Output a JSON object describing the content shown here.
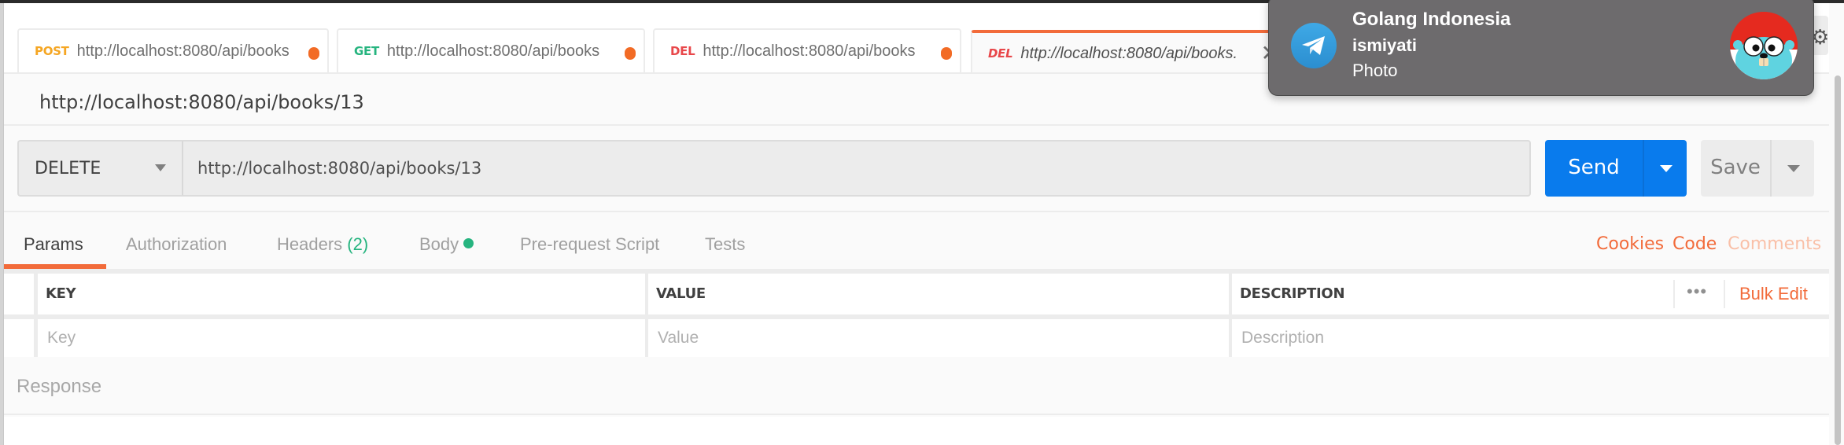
{
  "tabs": [
    {
      "method": "POST",
      "method_color": "#f5a623",
      "url": "http://localhost:8080/api/books",
      "unsaved": true
    },
    {
      "method": "GET",
      "method_color": "#26b47f",
      "url": "http://localhost:8080/api/books",
      "unsaved": true
    },
    {
      "method": "DEL",
      "method_color": "#e8474a",
      "url": "http://localhost:8080/api/books",
      "unsaved": true
    },
    {
      "method": "DEL",
      "method_color": "#e8474a",
      "url": "http://localhost:8080/api/books.",
      "active": true,
      "close_icon": "close-icon"
    }
  ],
  "request": {
    "name": "http://localhost:8080/api/books/13",
    "method": "DELETE",
    "url": "http://localhost:8080/api/books/13",
    "send_label": "Send",
    "save_label": "Save"
  },
  "request_tabs": [
    {
      "label": "Params",
      "active": true
    },
    {
      "label": "Authorization"
    },
    {
      "label": "Headers",
      "count": "(2)"
    },
    {
      "label": "Body",
      "indicator": "green-dot"
    },
    {
      "label": "Pre-request Script"
    },
    {
      "label": "Tests"
    }
  ],
  "right_links": {
    "cookies": "Cookies",
    "code": "Code",
    "comments": "Comments"
  },
  "params_table": {
    "headers": {
      "key": "KEY",
      "value": "VALUE",
      "description": "DESCRIPTION"
    },
    "more_label": "•••",
    "bulk_edit": "Bulk Edit",
    "placeholders": {
      "key": "Key",
      "value": "Value",
      "description": "Description"
    }
  },
  "response": {
    "label": "Response"
  },
  "notification": {
    "app": "Telegram",
    "title": "Golang Indonesia",
    "sender": "ismiyati",
    "message": "Photo"
  },
  "colors": {
    "accent": "#f26b3a",
    "send": "#097bed",
    "success": "#26b47f"
  }
}
